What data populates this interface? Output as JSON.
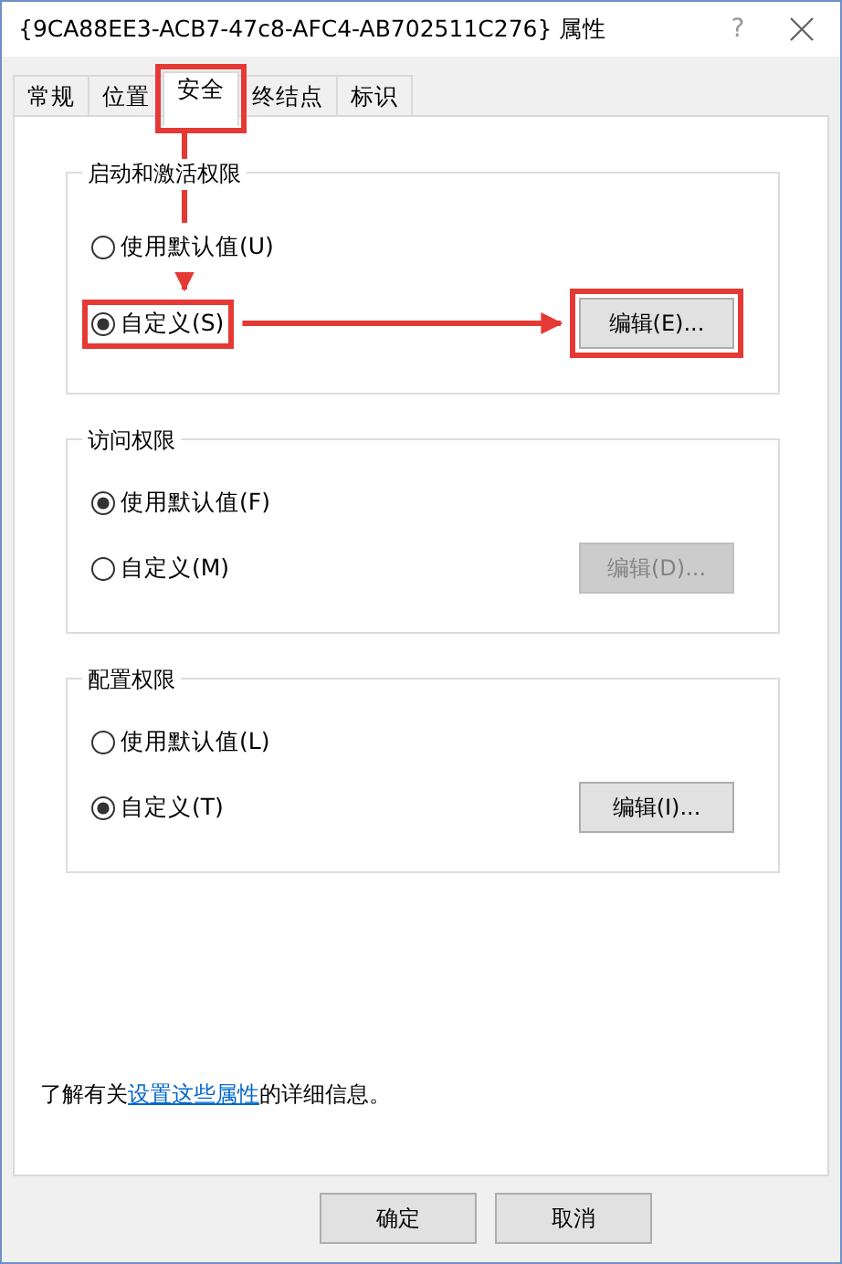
{
  "window": {
    "title": "{9CA88EE3-ACB7-47c8-AFC4-AB702511C276} 属性",
    "help": "?"
  },
  "tabs": [
    {
      "label": "常规",
      "selected": false,
      "highlighted": false
    },
    {
      "label": "位置",
      "selected": false,
      "highlighted": false
    },
    {
      "label": "安全",
      "selected": true,
      "highlighted": true
    },
    {
      "label": "终结点",
      "selected": false,
      "highlighted": false
    },
    {
      "label": "标识",
      "selected": false,
      "highlighted": false
    }
  ],
  "groups": [
    {
      "title": "启动和激活权限",
      "options": [
        {
          "label": "使用默认值(U)",
          "selected": false,
          "highlighted": false
        },
        {
          "label": "自定义(S)",
          "selected": true,
          "highlighted": true
        }
      ],
      "edit_button": {
        "label": "编辑(E)...",
        "disabled": false,
        "highlighted": true
      }
    },
    {
      "title": "访问权限",
      "options": [
        {
          "label": "使用默认值(F)",
          "selected": true,
          "highlighted": false
        },
        {
          "label": "自定义(M)",
          "selected": false,
          "highlighted": false
        }
      ],
      "edit_button": {
        "label": "编辑(D)...",
        "disabled": true,
        "highlighted": false
      }
    },
    {
      "title": "配置权限",
      "options": [
        {
          "label": "使用默认值(L)",
          "selected": false,
          "highlighted": false
        },
        {
          "label": "自定义(T)",
          "selected": true,
          "highlighted": false
        }
      ],
      "edit_button": {
        "label": "编辑(I)...",
        "disabled": false,
        "highlighted": false
      }
    }
  ],
  "info": {
    "before": "了解有关",
    "link": "设置这些属性",
    "after": "的详细信息。"
  },
  "buttons": [
    "确定",
    "取消"
  ]
}
